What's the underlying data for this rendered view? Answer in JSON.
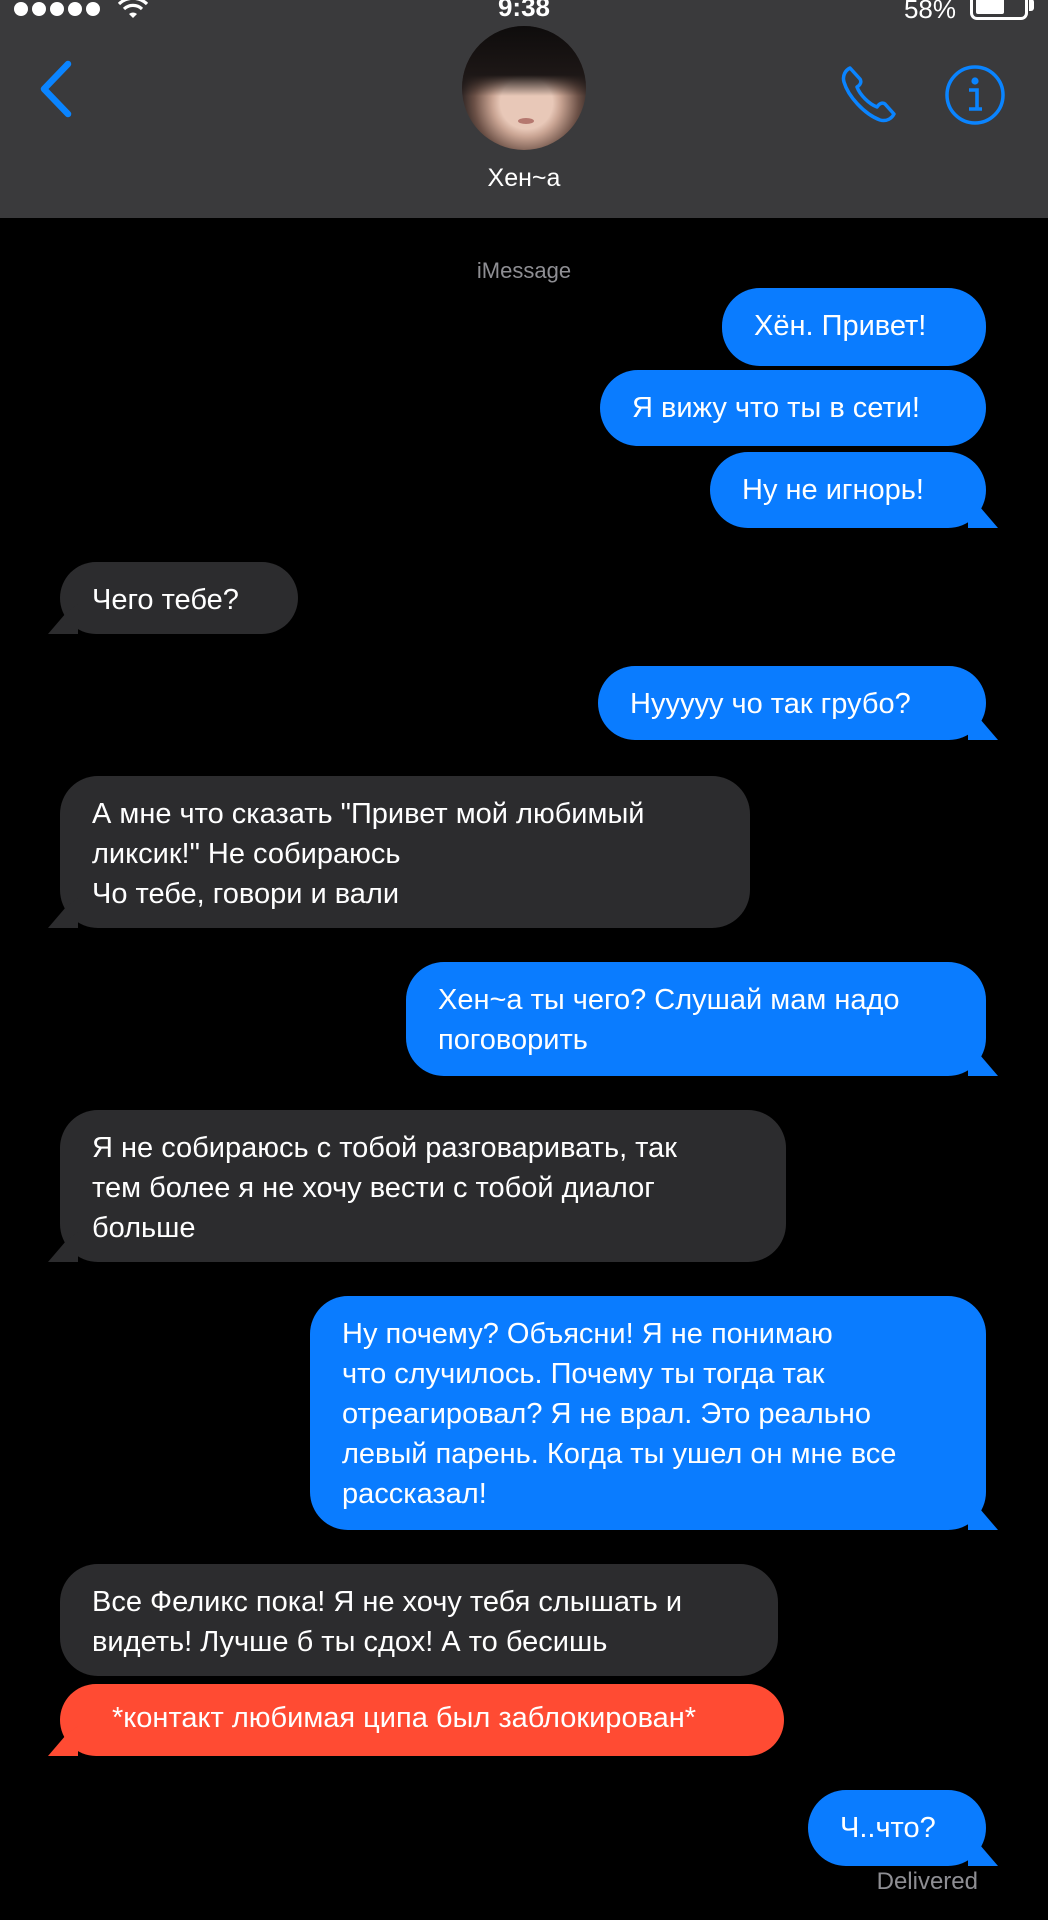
{
  "status_bar": {
    "time": "9:38",
    "battery": "58%"
  },
  "header": {
    "contact_name": "Хен~а"
  },
  "thread": {
    "service_label": "iMessage",
    "messages": [
      {
        "from": "me",
        "text": "Хён. Привет!"
      },
      {
        "from": "me",
        "text": "Я вижу что ты в сети!"
      },
      {
        "from": "me",
        "text": "Ну не игнорь!"
      },
      {
        "from": "them",
        "text": "Чего тебе?"
      },
      {
        "from": "me",
        "text": "Нууууу чо так грубо?"
      },
      {
        "from": "them",
        "text": "А мне что сказать \"Привет мой любимый\nликсик!\" Не собираюсь\nЧо тебе, говори и вали"
      },
      {
        "from": "me",
        "text": "Хен~а ты чего? Слушай мам надо\nпоговорить"
      },
      {
        "from": "them",
        "text": "Я не собираюсь с тобой разговаривать, так\nтем более я не хочу вести с тобой диалог\nбольше"
      },
      {
        "from": "me",
        "text": "Ну почему? Объясни! Я не понимаю\nчто случилось. Почему ты тогда так\nотреагировал? Я не врал. Это реально\nлевый парень. Когда ты ушел он мне все\nрассказал!"
      },
      {
        "from": "them",
        "text": "Все Феликс пока! Я не хочу тебя слышать и\nвидеть! Лучше б ты сдох! А то бесишь"
      },
      {
        "from": "system",
        "text": "*контакт любимая ципа был заблокирован*"
      },
      {
        "from": "me",
        "text": "Ч..что?"
      }
    ],
    "delivery_status": "Delivered"
  },
  "colors": {
    "outgoing": "#0a7cff",
    "incoming": "#2c2c2e",
    "alert": "#ff4b33",
    "accent": "#0a84ff",
    "header_bg": "#3a3a3c"
  },
  "icons": [
    "signal-dots-icon",
    "wifi-icon",
    "battery-icon",
    "back-chevron-icon",
    "phone-icon",
    "info-icon"
  ]
}
